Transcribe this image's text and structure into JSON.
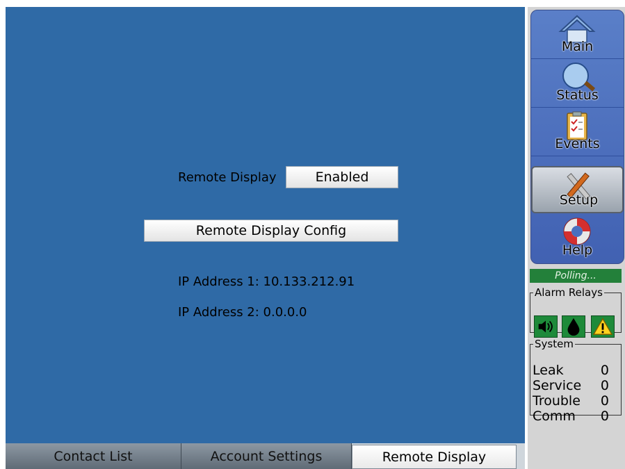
{
  "main": {
    "remote_display_label": "Remote Display",
    "remote_display_value": "Enabled",
    "config_button": "Remote Display Config",
    "ip1": "IP Address 1: 10.133.212.91",
    "ip2": "IP Address 2: 0.0.0.0"
  },
  "tabs": [
    {
      "label": "Contact List"
    },
    {
      "label": "Account Settings"
    },
    {
      "label": "Remote Display",
      "active": true
    }
  ],
  "nav": [
    {
      "label": "Main",
      "icon": "home-icon"
    },
    {
      "label": "Status",
      "icon": "magnifier-icon"
    },
    {
      "label": "Events",
      "icon": "clipboard-icon"
    },
    {
      "label": "Setup",
      "icon": "tools-icon",
      "active": true
    },
    {
      "label": "Help",
      "icon": "lifebuoy-icon"
    }
  ],
  "status": {
    "polling": "Polling..."
  },
  "relays": {
    "title": "Alarm Relays",
    "icons": [
      "speaker-icon",
      "drop-icon",
      "warning-icon"
    ]
  },
  "system": {
    "title": "System",
    "rows": [
      {
        "label": "Leak",
        "value": "0"
      },
      {
        "label": "Service",
        "value": "0"
      },
      {
        "label": "Trouble",
        "value": "0"
      },
      {
        "label": "Comm",
        "value": "0"
      }
    ]
  },
  "colors": {
    "panel_bg": "#2f6aa6",
    "polling_bg": "#23803a",
    "relay_bg": "#1e8a3a",
    "nav_bg": "#4a6fbf"
  }
}
